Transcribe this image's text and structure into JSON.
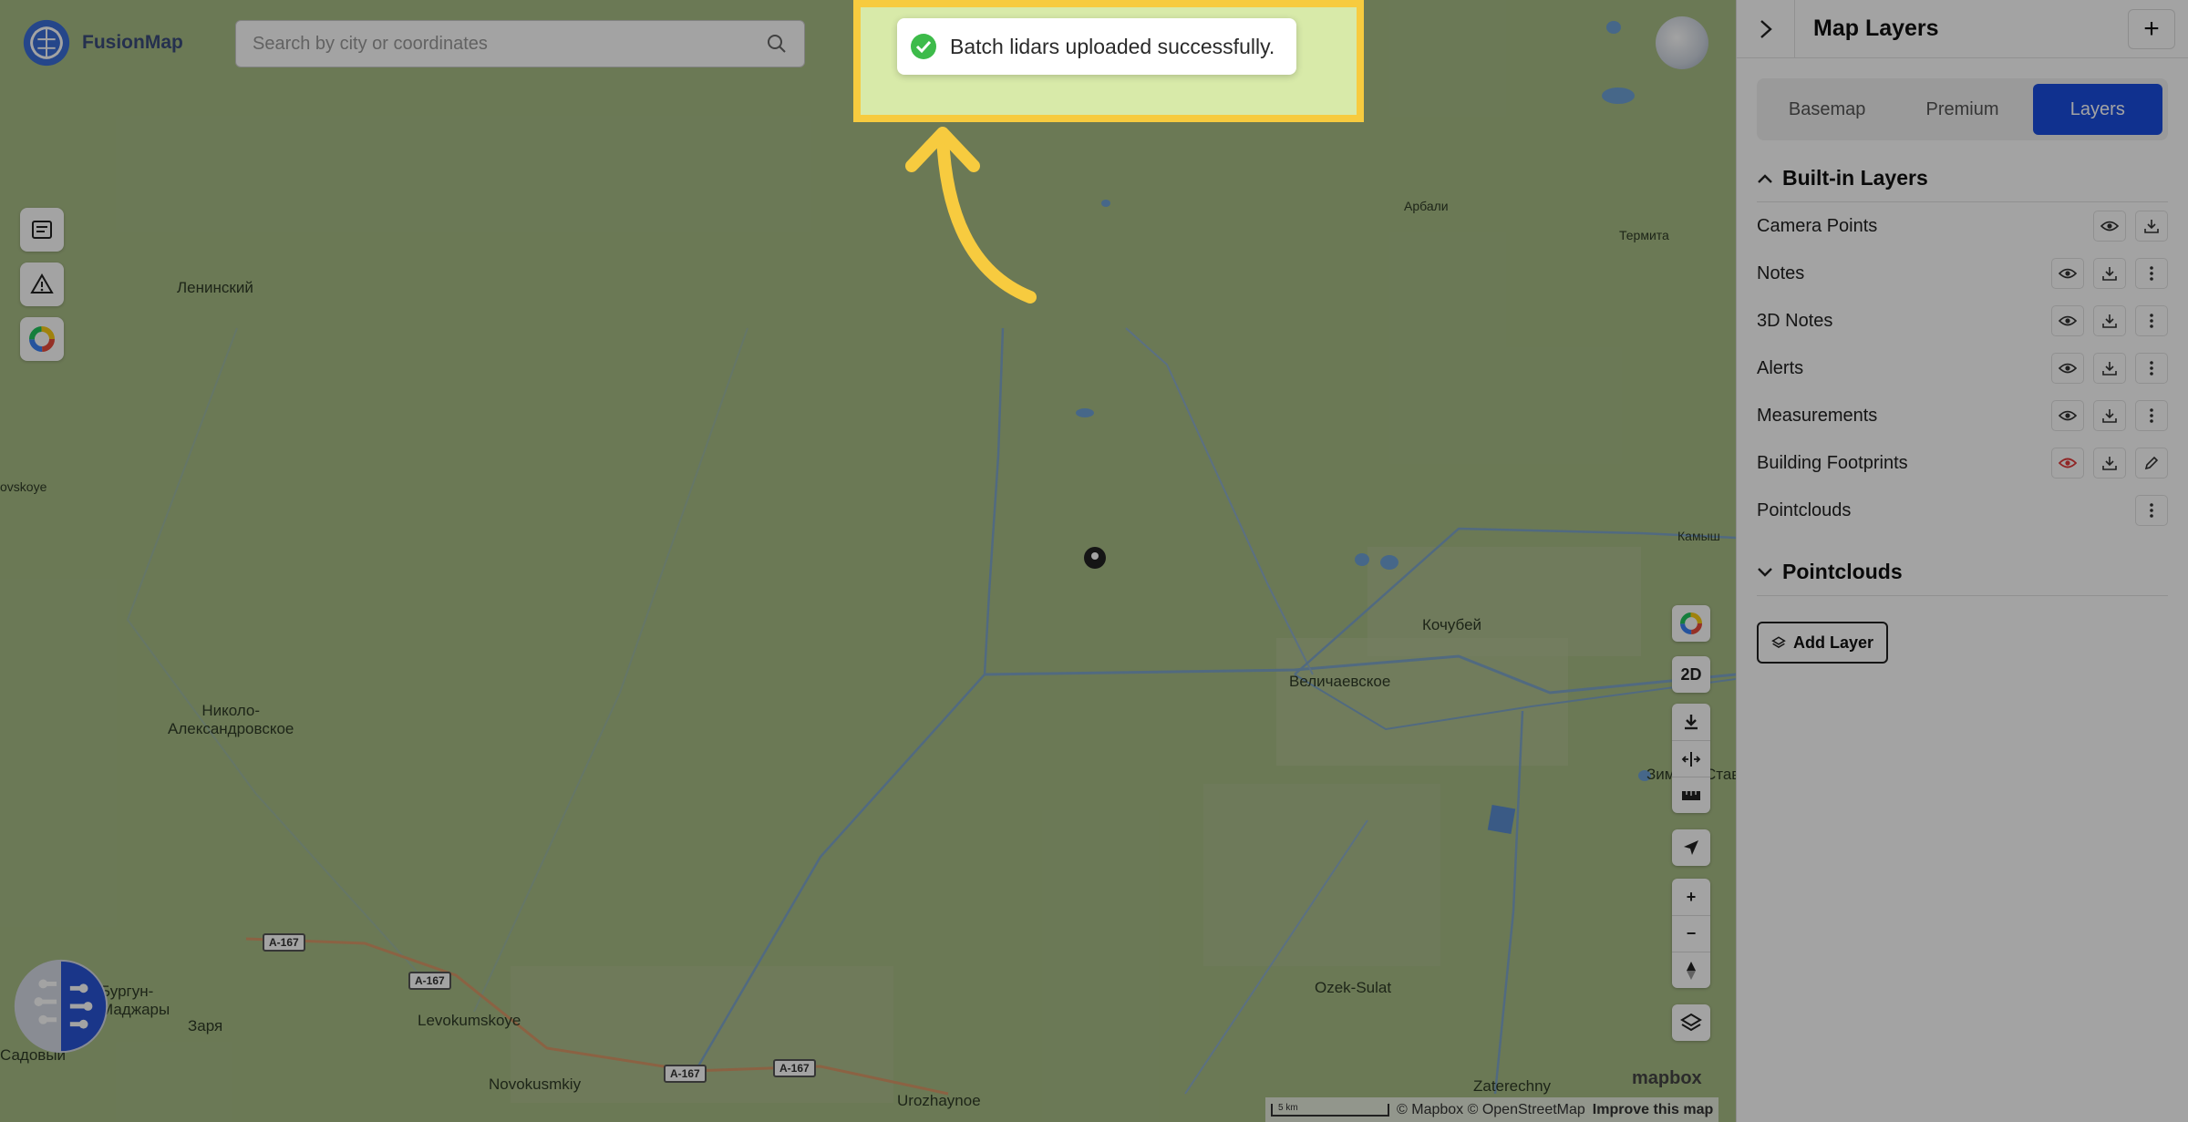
{
  "brand": {
    "name": "FusionMap"
  },
  "search": {
    "placeholder": "Search by city or coordinates"
  },
  "toast": {
    "message": "Batch lidars uploaded successfully."
  },
  "map": {
    "places": [
      {
        "id": "leninsky",
        "text": "Ленинский"
      },
      {
        "id": "ovskoye",
        "text": "ovskoye"
      },
      {
        "id": "arbali",
        "text": "Арбали"
      },
      {
        "id": "termita",
        "text": "Термита"
      },
      {
        "id": "kamysh",
        "text": "Камыш"
      },
      {
        "id": "kochubey",
        "text": "Кочубей"
      },
      {
        "id": "velichaevskoe",
        "text": "Величаевское"
      },
      {
        "id": "nikolo",
        "text": "Николо-\nАлександровское"
      },
      {
        "id": "zimnya",
        "text": "Зимняя Ставка"
      },
      {
        "id": "burgun",
        "text": "Бургун-\nМаджары"
      },
      {
        "id": "zarya",
        "text": "Заря"
      },
      {
        "id": "sadovy",
        "text": "Садовый"
      },
      {
        "id": "levokumskoye",
        "text": "Levokumskoye"
      },
      {
        "id": "novokusmkiy",
        "text": "Novokusmkiy"
      },
      {
        "id": "urozhaynoe",
        "text": "Urozhaynoe"
      },
      {
        "id": "ozek",
        "text": "Ozek-Sulat"
      },
      {
        "id": "zaterechny",
        "text": "Zaterechny"
      }
    ],
    "road_shields": [
      "A-167",
      "A-167",
      "A-167",
      "A-167"
    ],
    "controls": {
      "mode_label": "2D",
      "zoom_in": "+",
      "zoom_out": "−"
    },
    "mapbox_logo": "mapbox",
    "scale_label": "5 km",
    "attribution": "© Mapbox © OpenStreetMap",
    "improve_link": "Improve this map"
  },
  "panel": {
    "title": "Map Layers",
    "add_label": "+",
    "tabs": [
      {
        "label": "Basemap",
        "active": false
      },
      {
        "label": "Premium",
        "active": false
      },
      {
        "label": "Layers",
        "active": true
      }
    ],
    "builtin_section": "Built-in Layers",
    "layers": [
      {
        "label": "Camera Points",
        "actions": [
          "eye",
          "download"
        ]
      },
      {
        "label": "Notes",
        "actions": [
          "eye",
          "download",
          "more"
        ]
      },
      {
        "label": "3D Notes",
        "actions": [
          "eye",
          "download",
          "more"
        ]
      },
      {
        "label": "Alerts",
        "actions": [
          "eye",
          "download",
          "more"
        ]
      },
      {
        "label": "Measurements",
        "actions": [
          "eye",
          "download",
          "more"
        ]
      },
      {
        "label": "Building Footprints",
        "actions": [
          "eye-red",
          "download",
          "edit"
        ]
      },
      {
        "label": "Pointclouds",
        "actions": [
          "more"
        ]
      }
    ],
    "pointclouds_section": "Pointclouds",
    "add_layer_label": "Add Layer"
  },
  "colors": {
    "accent": "#1a4de0",
    "highlight_border": "#f7cb3f",
    "success": "#3dbb4a",
    "map_base": "#a8bd86"
  }
}
